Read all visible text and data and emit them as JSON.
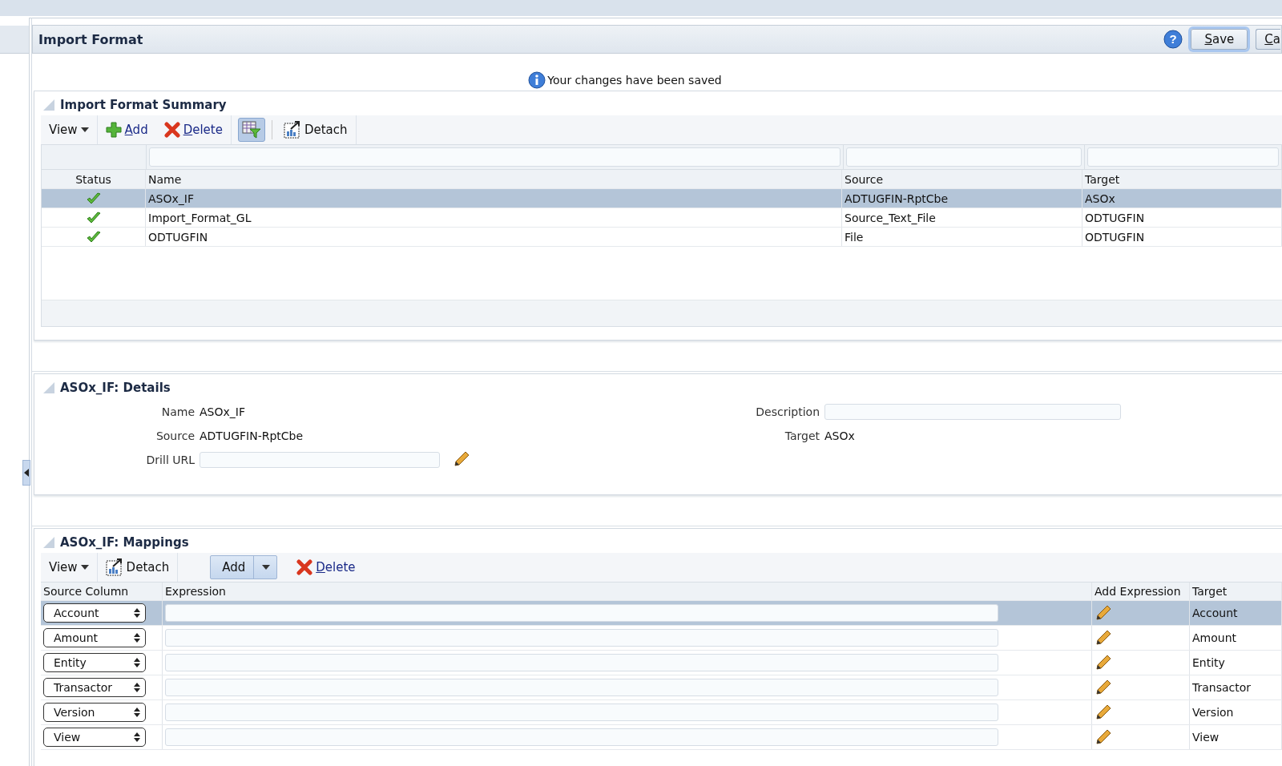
{
  "page": {
    "title": "Import Format",
    "help": "?",
    "buttons": [
      {
        "label": "Save",
        "focused": true
      },
      {
        "label": "Ca",
        "focused": false
      }
    ]
  },
  "message": "Your changes have been saved",
  "summary": {
    "title": "Import Format Summary",
    "toolbar": {
      "view": "View",
      "add": "Add",
      "delete": "Delete",
      "detach": "Detach"
    },
    "columns": [
      "Status",
      "Name",
      "Source",
      "Target"
    ],
    "rows": [
      {
        "ok": true,
        "name": "ASOx_IF",
        "source": "ADTUGFIN-RptCbe",
        "target": "ASOx",
        "selected": true
      },
      {
        "ok": true,
        "name": "Import_Format_GL",
        "source": "Source_Text_File",
        "target": "ODTUGFIN",
        "selected": false
      },
      {
        "ok": true,
        "name": "ODTUGFIN",
        "source": "File",
        "target": "ODTUGFIN",
        "selected": false
      }
    ]
  },
  "details": {
    "title": "ASOx_IF: Details",
    "name_label": "Name",
    "name": "ASOx_IF",
    "source_label": "Source",
    "source": "ADTUGFIN-RptCbe",
    "drill_label": "Drill URL",
    "description_label": "Description",
    "target_label": "Target",
    "target": "ASOx"
  },
  "mappings": {
    "title": "ASOx_IF: Mappings",
    "toolbar": {
      "view": "View",
      "detach": "Detach",
      "add": "Add",
      "delete": "Delete"
    },
    "columns": [
      "Source Column",
      "Expression",
      "Add Expression",
      "Target"
    ],
    "rows": [
      {
        "source": "Account",
        "target": "Account",
        "selected": true
      },
      {
        "source": "Amount",
        "target": "Amount",
        "selected": false
      },
      {
        "source": "Entity",
        "target": "Entity",
        "selected": false
      },
      {
        "source": "Transactor",
        "target": "Transactor",
        "selected": false
      },
      {
        "source": "Version",
        "target": "Version",
        "selected": false
      },
      {
        "source": "View",
        "target": "View",
        "selected": false
      }
    ]
  }
}
